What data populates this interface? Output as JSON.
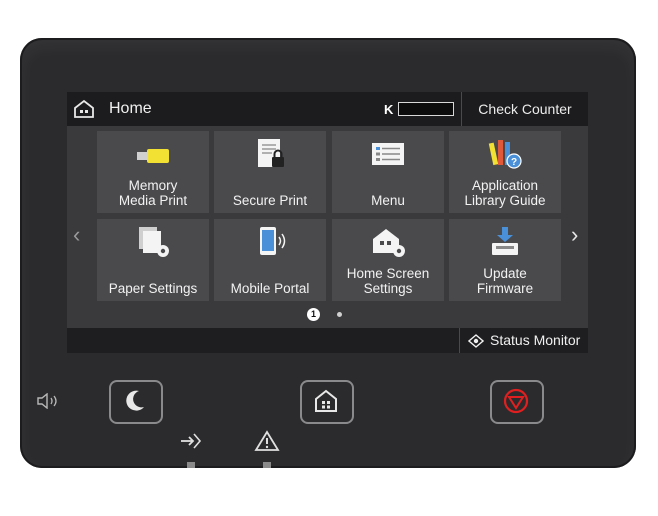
{
  "header": {
    "title": "Home",
    "toner_label": "K",
    "check_counter_label": "Check Counter"
  },
  "tiles": [
    {
      "label_line1": "Memory",
      "label_line2": "Media Print",
      "icon": "usb-memory-icon"
    },
    {
      "label_line1": "Secure Print",
      "label_line2": "",
      "icon": "secure-print-icon"
    },
    {
      "label_line1": "Menu",
      "label_line2": "",
      "icon": "menu-list-icon"
    },
    {
      "label_line1": "Application",
      "label_line2": "Library Guide",
      "icon": "application-library-icon"
    },
    {
      "label_line1": "Paper Settings",
      "label_line2": "",
      "icon": "paper-settings-icon"
    },
    {
      "label_line1": "Mobile Portal",
      "label_line2": "",
      "icon": "mobile-portal-icon"
    },
    {
      "label_line1": "Home Screen",
      "label_line2": "Settings",
      "icon": "home-screen-settings-icon"
    },
    {
      "label_line1": "Update",
      "label_line2": "Firmware",
      "icon": "update-firmware-icon"
    }
  ],
  "pager": {
    "current_page": "1",
    "total_pages": 2
  },
  "footer": {
    "status_monitor_label": "Status Monitor"
  },
  "colors": {
    "stop_button": "#e02020",
    "screen_bg": "#3a3a3c",
    "tile_bg": "#4a4a4d"
  }
}
